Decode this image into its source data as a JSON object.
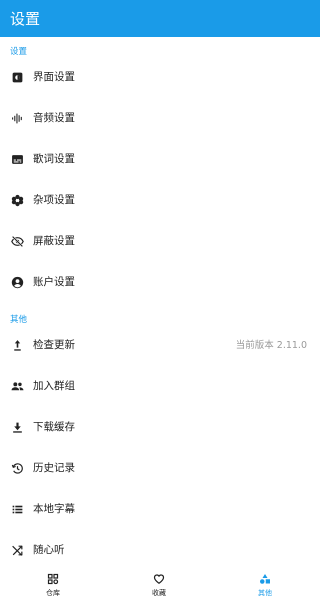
{
  "app_bar": {
    "title": "设置"
  },
  "sections": {
    "settings": {
      "header": "设置"
    },
    "other": {
      "header": "其他"
    }
  },
  "rows": {
    "ui": {
      "label": "界面设置",
      "icon": "brightness-icon"
    },
    "audio": {
      "label": "音频设置",
      "icon": "waveform-icon"
    },
    "lyrics": {
      "label": "歌词设置",
      "icon": "subtitles-icon"
    },
    "misc": {
      "label": "杂项设置",
      "icon": "flower-icon"
    },
    "block": {
      "label": "屏蔽设置",
      "icon": "eye-off-icon"
    },
    "account": {
      "label": "账户设置",
      "icon": "account-icon"
    },
    "update": {
      "label": "检查更新",
      "icon": "arrow-up-icon",
      "value": "当前版本 2.11.0"
    },
    "group": {
      "label": "加入群组",
      "icon": "group-icon"
    },
    "cache": {
      "label": "下载缓存",
      "icon": "download-icon"
    },
    "history": {
      "label": "历史记录",
      "icon": "history-icon"
    },
    "subtitles": {
      "label": "本地字幕",
      "icon": "list-icon"
    },
    "shuffle": {
      "label": "随心听",
      "icon": "shuffle-icon"
    }
  },
  "bottom_nav": {
    "library": {
      "label": "仓库",
      "icon": "grid-icon"
    },
    "favorites": {
      "label": "收藏",
      "icon": "heart-icon"
    },
    "other": {
      "label": "其他",
      "icon": "shapes-icon",
      "active": true
    }
  },
  "colors": {
    "accent": "#1a9be8",
    "text": "#222222",
    "secondary": "#9a9a9a",
    "background": "#ffffff"
  }
}
